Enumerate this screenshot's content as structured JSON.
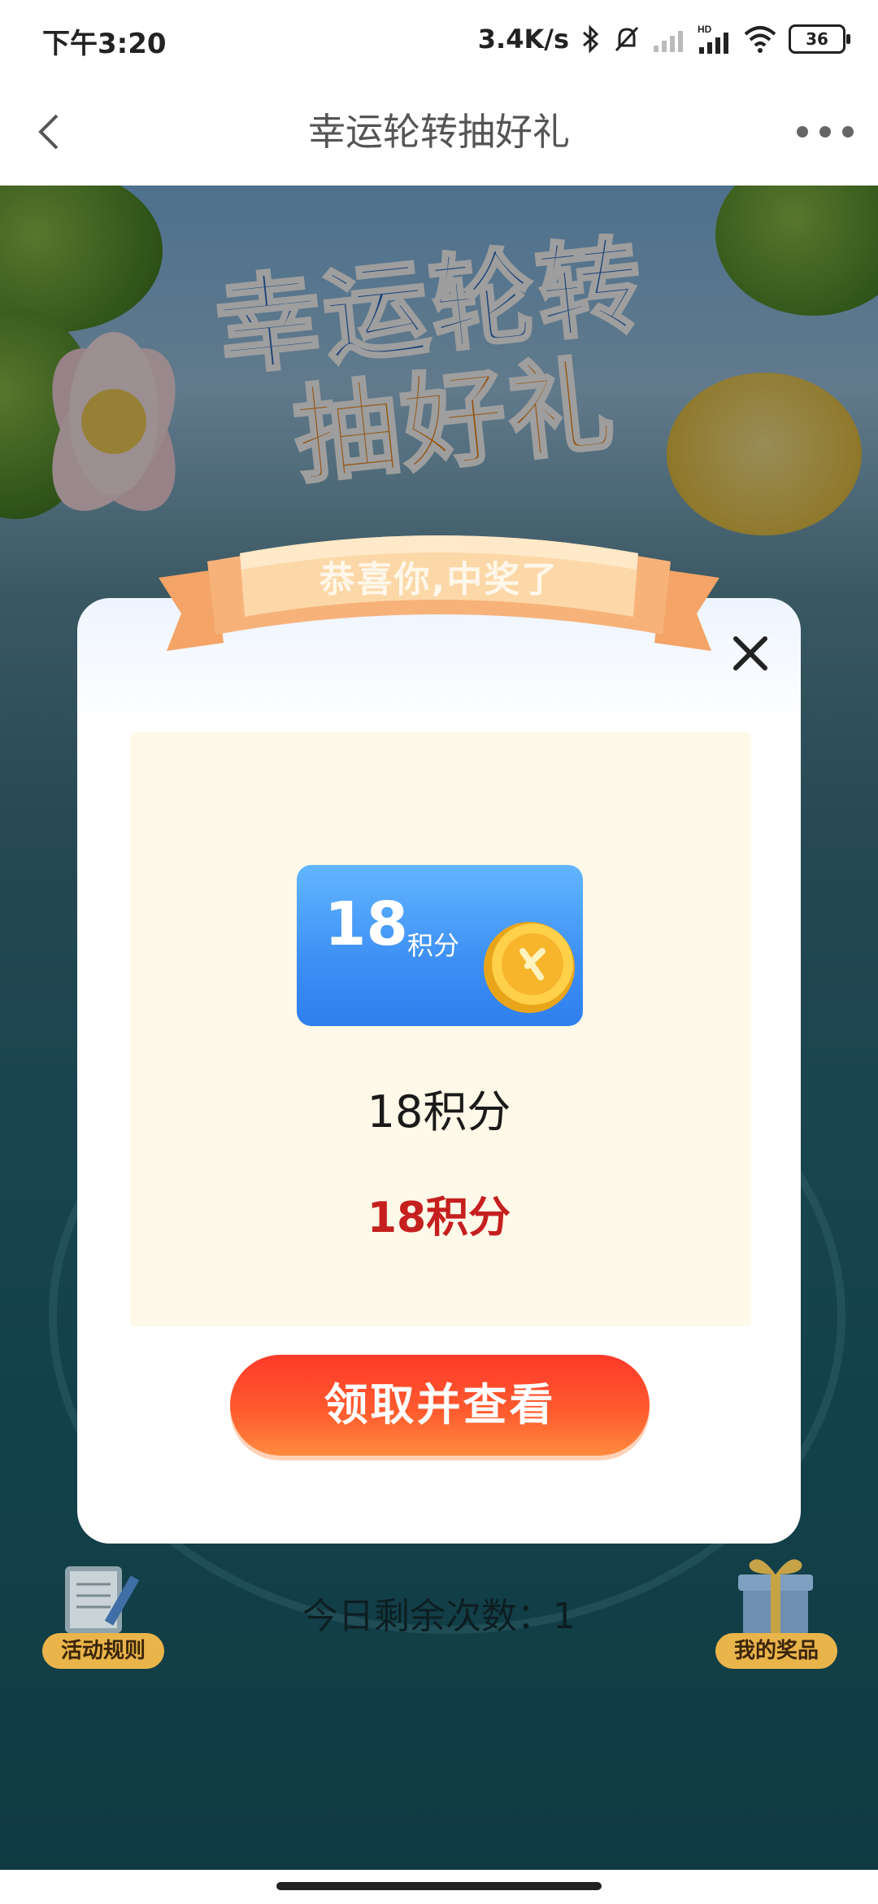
{
  "status_bar": {
    "time": "下午3:20",
    "net_speed": "3.4K/s",
    "battery": "36"
  },
  "nav": {
    "title": "幸运轮转抽好礼"
  },
  "banner": {
    "line1": "幸运轮转",
    "line2": "抽好礼"
  },
  "modal": {
    "ribbon_text": "恭喜你,中奖了",
    "prize_card_amount": "18",
    "prize_card_unit": "积分",
    "prize_name": "18积分",
    "prize_value": "18积分",
    "claim_button": "领取并查看"
  },
  "footer": {
    "rules_label": "活动规则",
    "prizes_label": "我的奖品",
    "remaining_text": "今日剩余次数：1"
  },
  "colors": {
    "accent_red": "#c61f1f",
    "button_orange": "#ff5a2e",
    "card_blue": "#3d8ff4"
  }
}
